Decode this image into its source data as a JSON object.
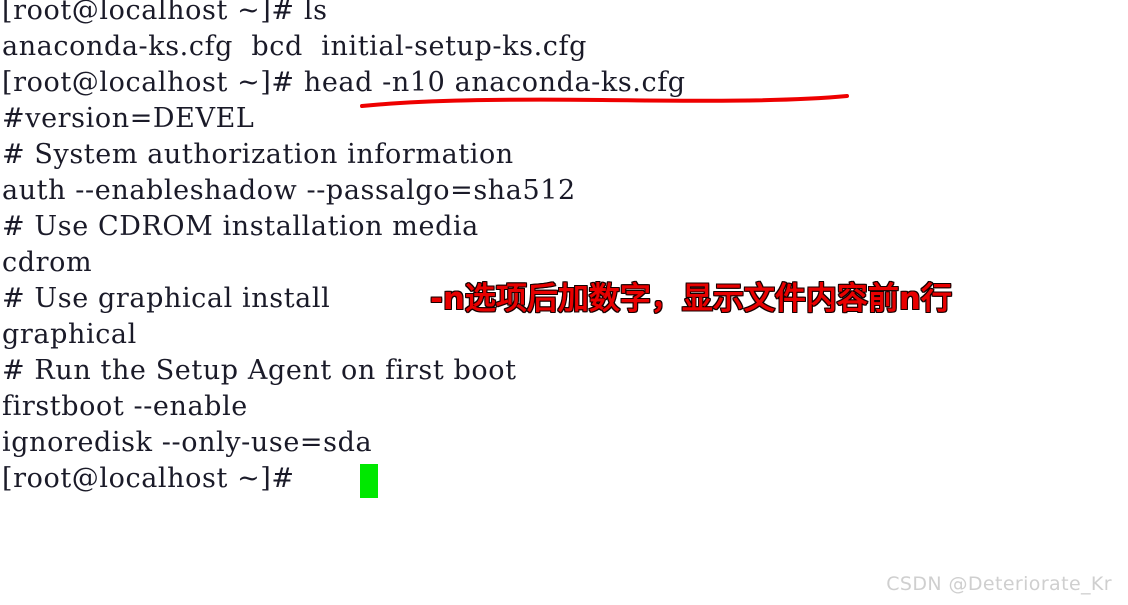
{
  "terminal": {
    "background_color": "#ffffff",
    "text_color": "#1a1a28",
    "cursor_color": "#00e800",
    "lines": [
      {
        "text": "[root@localhost ~]# ls"
      },
      {
        "text": "anaconda-ks.cfg  bcd  initial-setup-ks.cfg"
      },
      {
        "text": "[root@localhost ~]# head -n10 anaconda-ks.cfg"
      },
      {
        "text": "#version=DEVEL"
      },
      {
        "text": "# System authorization information"
      },
      {
        "text": "auth --enableshadow --passalgo=sha512"
      },
      {
        "text": "# Use CDROM installation media"
      },
      {
        "text": "cdrom"
      },
      {
        "text": "# Use graphical install"
      },
      {
        "text": "graphical"
      },
      {
        "text": "# Run the Setup Agent on first boot"
      },
      {
        "text": "firstboot --enable"
      },
      {
        "text": "ignoredisk --only-use=sda"
      },
      {
        "text": "[root@localhost ~]# "
      }
    ]
  },
  "annotations": {
    "underline": {
      "label": "red-underline-under-head-command",
      "color": "#ee0000",
      "target_text": "head -n10 anaconda-ks.cfg"
    },
    "note": {
      "text": "-n选项后加数字，显示文件内容前n行",
      "color": "#e80000",
      "outline_color": "#150000"
    }
  },
  "watermark": {
    "text": "CSDN @Deteriorate_Kr",
    "color": "#cfcfcf"
  }
}
